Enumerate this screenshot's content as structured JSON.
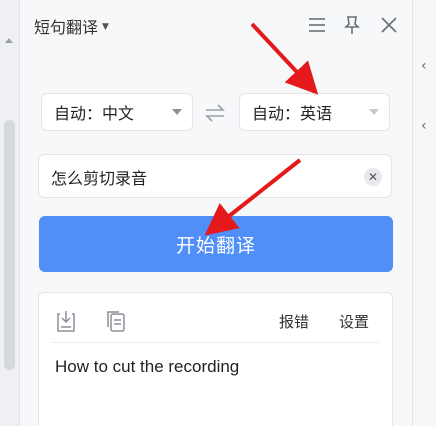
{
  "header": {
    "title": "短句翻译",
    "icons": [
      "menu-icon",
      "pin-icon",
      "close-icon"
    ]
  },
  "source_lang": {
    "value": "自动：中文"
  },
  "target_lang": {
    "value": "自动：英语"
  },
  "input": {
    "value": "怎么剪切录音"
  },
  "translate_button": {
    "label": "开始翻译"
  },
  "result": {
    "text": "How to cut the recording",
    "report_label": "报错",
    "settings_label": "设置"
  },
  "colors": {
    "accent": "#4f8ff7",
    "annotation_arrow": "#e5191b"
  }
}
